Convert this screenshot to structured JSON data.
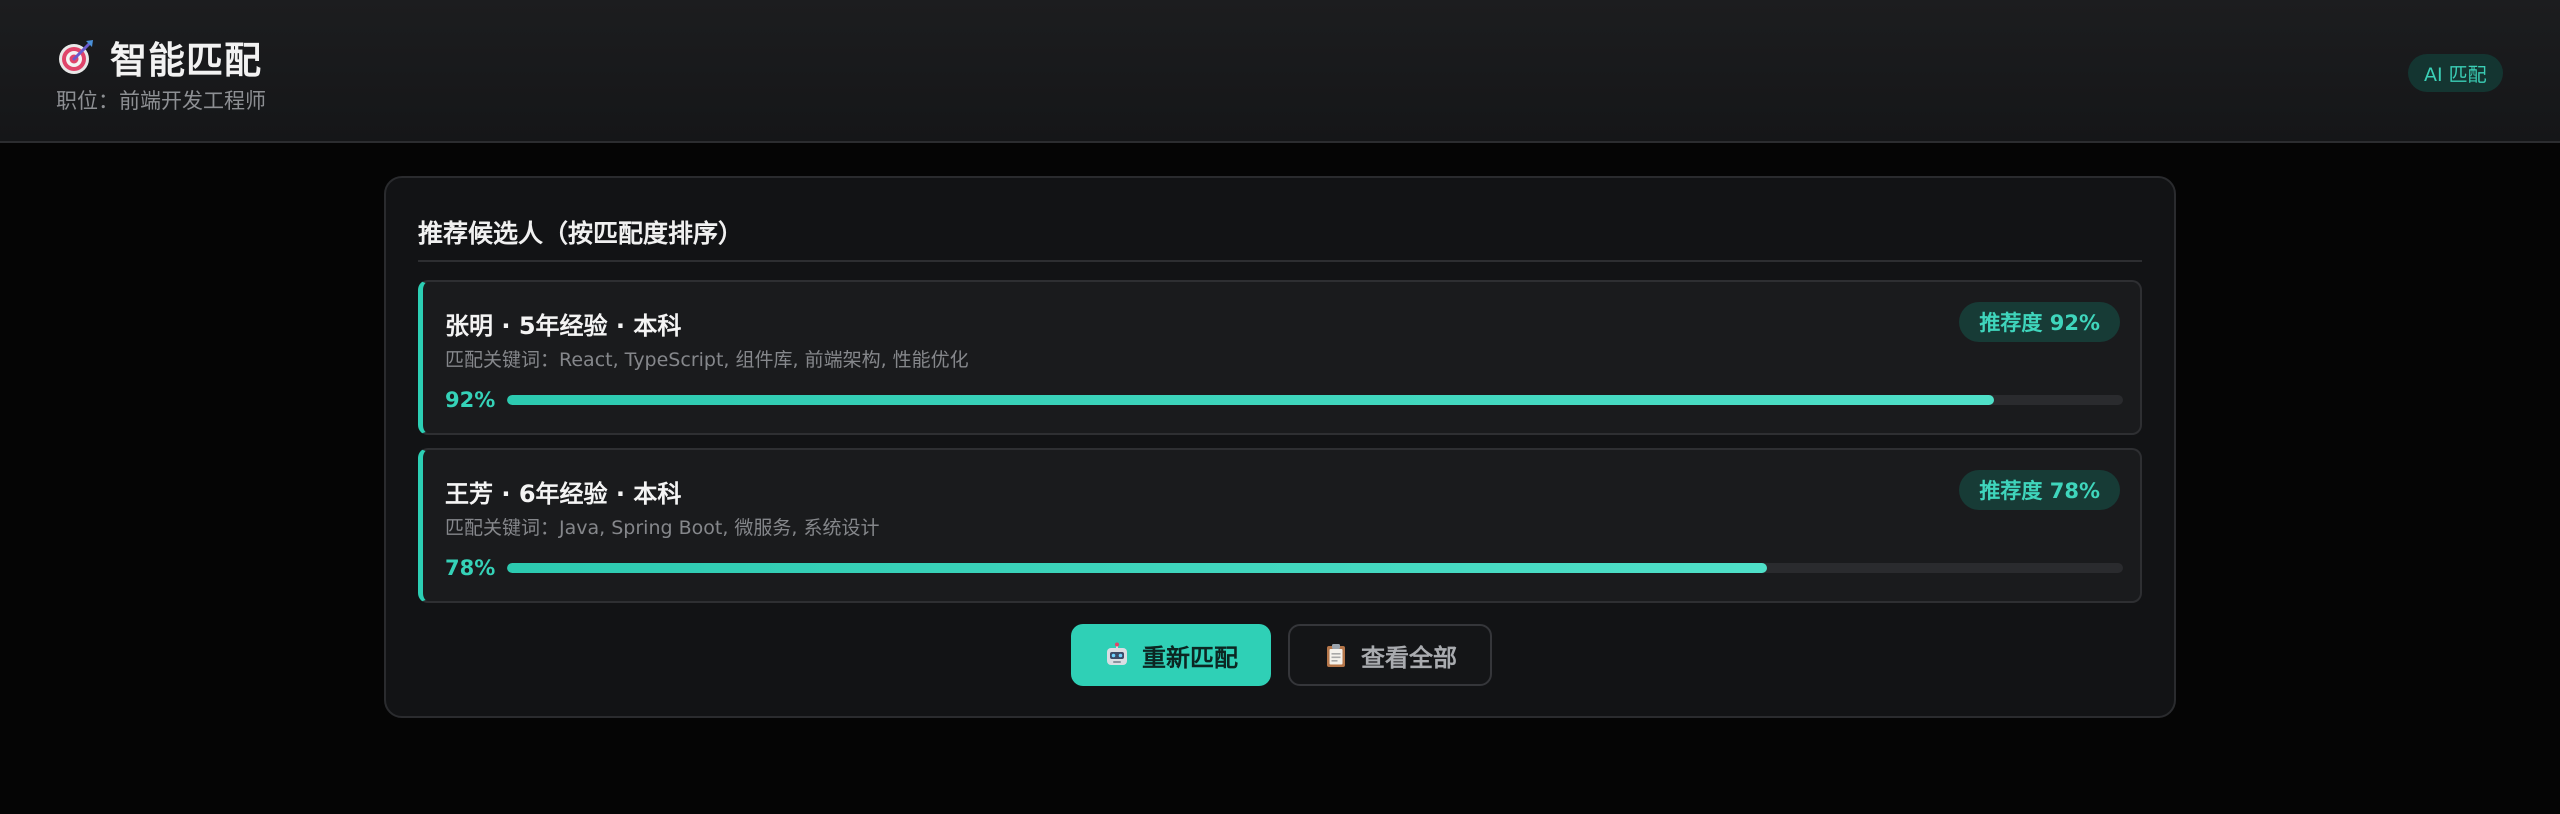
{
  "header": {
    "icon": "target-icon",
    "title": "智能匹配",
    "subtitle": "职位：前端开发工程师",
    "badge": "AI 匹配"
  },
  "panel": {
    "title": "推荐候选人（按匹配度排序）",
    "candidates": [
      {
        "name": "张明 · 5年经验 · 本科",
        "keywords_label": "匹配关键词：",
        "keywords": "React, TypeScript, 组件库, 前端架构, 性能优化",
        "badge": "推荐度 92%",
        "percent_label": "92%",
        "match": 0.92
      },
      {
        "name": "王芳 · 6年经验 · 本科",
        "keywords_label": "匹配关键词：",
        "keywords": "Java, Spring Boot, 微服务, 系统设计",
        "badge": "推荐度 78%",
        "percent_label": "78%",
        "match": 0.78
      }
    ]
  },
  "actions": {
    "rematch": {
      "label": "重新匹配",
      "icon": "robot-icon"
    },
    "view_all": {
      "label": "查看全部",
      "icon": "clipboard-icon"
    }
  },
  "colors": {
    "accent": "#2fd0b6",
    "background": "#050505",
    "card": "#1a1b1d"
  }
}
